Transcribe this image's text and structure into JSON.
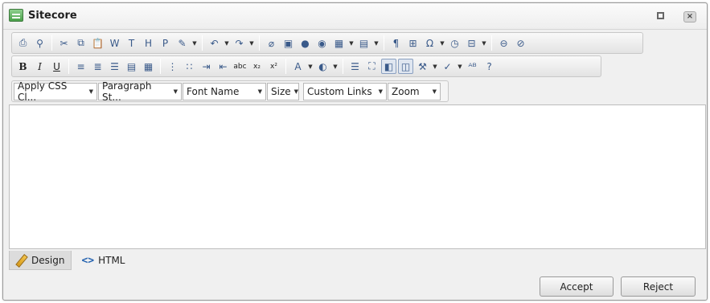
{
  "window": {
    "title": "Sitecore"
  },
  "toolbar_rows": [
    {
      "name": "toolbar-row-1",
      "items": [
        {
          "n": "print-icon",
          "g": "⎙"
        },
        {
          "n": "find-replace-icon",
          "g": "⚲"
        },
        {
          "n": "sep"
        },
        {
          "n": "cut-icon",
          "g": "✂"
        },
        {
          "n": "copy-icon",
          "g": "⧉"
        },
        {
          "n": "paste-icon",
          "g": "📋"
        },
        {
          "n": "paste-from-word-icon",
          "g": "W"
        },
        {
          "n": "paste-plain-text-icon",
          "g": "T"
        },
        {
          "n": "paste-as-html-icon",
          "g": "H"
        },
        {
          "n": "paste-options-icon",
          "g": "P"
        },
        {
          "n": "format-stripper-icon",
          "g": "✎",
          "drop": true
        },
        {
          "n": "sep"
        },
        {
          "n": "undo-icon",
          "g": "↶",
          "drop": true
        },
        {
          "n": "redo-icon",
          "g": "↷",
          "drop": true
        },
        {
          "n": "sep"
        },
        {
          "n": "insert-link-icon",
          "g": "⌀"
        },
        {
          "n": "insert-media-icon",
          "g": "▣"
        },
        {
          "n": "insert-sitecore-link-icon",
          "g": "●"
        },
        {
          "n": "insert-sitecore-media-icon",
          "g": "◉"
        },
        {
          "n": "insert-table-icon",
          "g": "▦",
          "drop": true
        },
        {
          "n": "insert-snippet-icon",
          "g": "▤",
          "drop": true
        },
        {
          "n": "sep"
        },
        {
          "n": "show-paragraph-icon",
          "g": "¶"
        },
        {
          "n": "insert-symbol-ext-icon",
          "g": "⊞"
        },
        {
          "n": "insert-symbol-icon",
          "g": "Ω",
          "drop": true
        },
        {
          "n": "insert-date-icon",
          "g": "◷"
        },
        {
          "n": "insert-field-icon",
          "g": "⊟",
          "drop": true
        },
        {
          "n": "sep"
        },
        {
          "n": "module-manager-icon",
          "g": "⊖"
        },
        {
          "n": "about-icon",
          "g": "⊘"
        }
      ]
    },
    {
      "name": "toolbar-row-2",
      "items": [
        {
          "n": "bold-icon",
          "g": "B",
          "c": "bold"
        },
        {
          "n": "italic-icon",
          "g": "I",
          "c": "ital"
        },
        {
          "n": "underline-icon",
          "g": "U",
          "c": "ul"
        },
        {
          "n": "sep"
        },
        {
          "n": "align-left-icon",
          "g": "≡"
        },
        {
          "n": "align-center-icon",
          "g": "≣"
        },
        {
          "n": "align-right-icon",
          "g": "☰"
        },
        {
          "n": "justify-icon",
          "g": "▤"
        },
        {
          "n": "remove-alignment-icon",
          "g": "▦"
        },
        {
          "n": "sep"
        },
        {
          "n": "numbered-list-icon",
          "g": "⋮"
        },
        {
          "n": "bulleted-list-icon",
          "g": "∷"
        },
        {
          "n": "indent-icon",
          "g": "⇥"
        },
        {
          "n": "outdent-icon",
          "g": "⇤"
        },
        {
          "n": "strikethrough-icon",
          "g": "abc",
          "c": "small"
        },
        {
          "n": "subscript-icon",
          "g": "x₂",
          "c": "small"
        },
        {
          "n": "superscript-icon",
          "g": "x²",
          "c": "small"
        },
        {
          "n": "sep"
        },
        {
          "n": "font-color-icon",
          "g": "A",
          "drop": true
        },
        {
          "n": "highlight-icon",
          "g": "◐",
          "drop": true
        },
        {
          "n": "sep"
        },
        {
          "n": "horizontal-rule-icon",
          "g": "☰"
        },
        {
          "n": "select-all-icon",
          "g": "⛶"
        },
        {
          "n": "image-properties-icon",
          "g": "◧",
          "c": "active"
        },
        {
          "n": "toggle-borders-icon",
          "g": "◫",
          "c": "active"
        },
        {
          "n": "format-painter-icon",
          "g": "⚒",
          "drop": true
        },
        {
          "n": "spellcheck-icon",
          "g": "✓",
          "drop": true
        },
        {
          "n": "ajax-spellcheck-icon",
          "g": "ᴬᴮ"
        },
        {
          "n": "help-icon",
          "g": "?"
        }
      ]
    }
  ],
  "dropdowns": [
    {
      "name": "css-class-dropdown",
      "label": "Apply CSS Cl...",
      "w": 104
    },
    {
      "name": "paragraph-style-dropdown",
      "label": "Paragraph St...",
      "w": 104
    },
    {
      "name": "font-name-dropdown",
      "label": "Font Name",
      "w": 104
    },
    {
      "name": "font-size-dropdown",
      "label": "Size",
      "w": 40
    },
    {
      "name": "custom-links-dropdown",
      "label": "Custom Links",
      "w": 104
    },
    {
      "name": "zoom-dropdown",
      "label": "Zoom",
      "w": 66
    }
  ],
  "modes": {
    "design": "Design",
    "html": "HTML"
  },
  "buttons": {
    "accept": "Accept",
    "reject": "Reject"
  }
}
